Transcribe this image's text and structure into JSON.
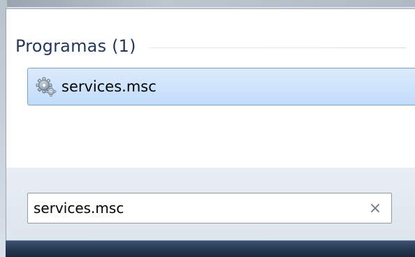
{
  "results": {
    "group_title": "Programas (1)",
    "items": [
      {
        "label": "services.msc",
        "icon": "gear-icon",
        "selected": true
      }
    ]
  },
  "search": {
    "value": "services.msc",
    "clear_glyph": "×"
  },
  "colors": {
    "group_title": "#1e395b",
    "selection_top": "#dcebfc",
    "selection_bottom": "#c1dcfc",
    "selection_border": "#7da2ce",
    "taskbar": "#23364d"
  }
}
